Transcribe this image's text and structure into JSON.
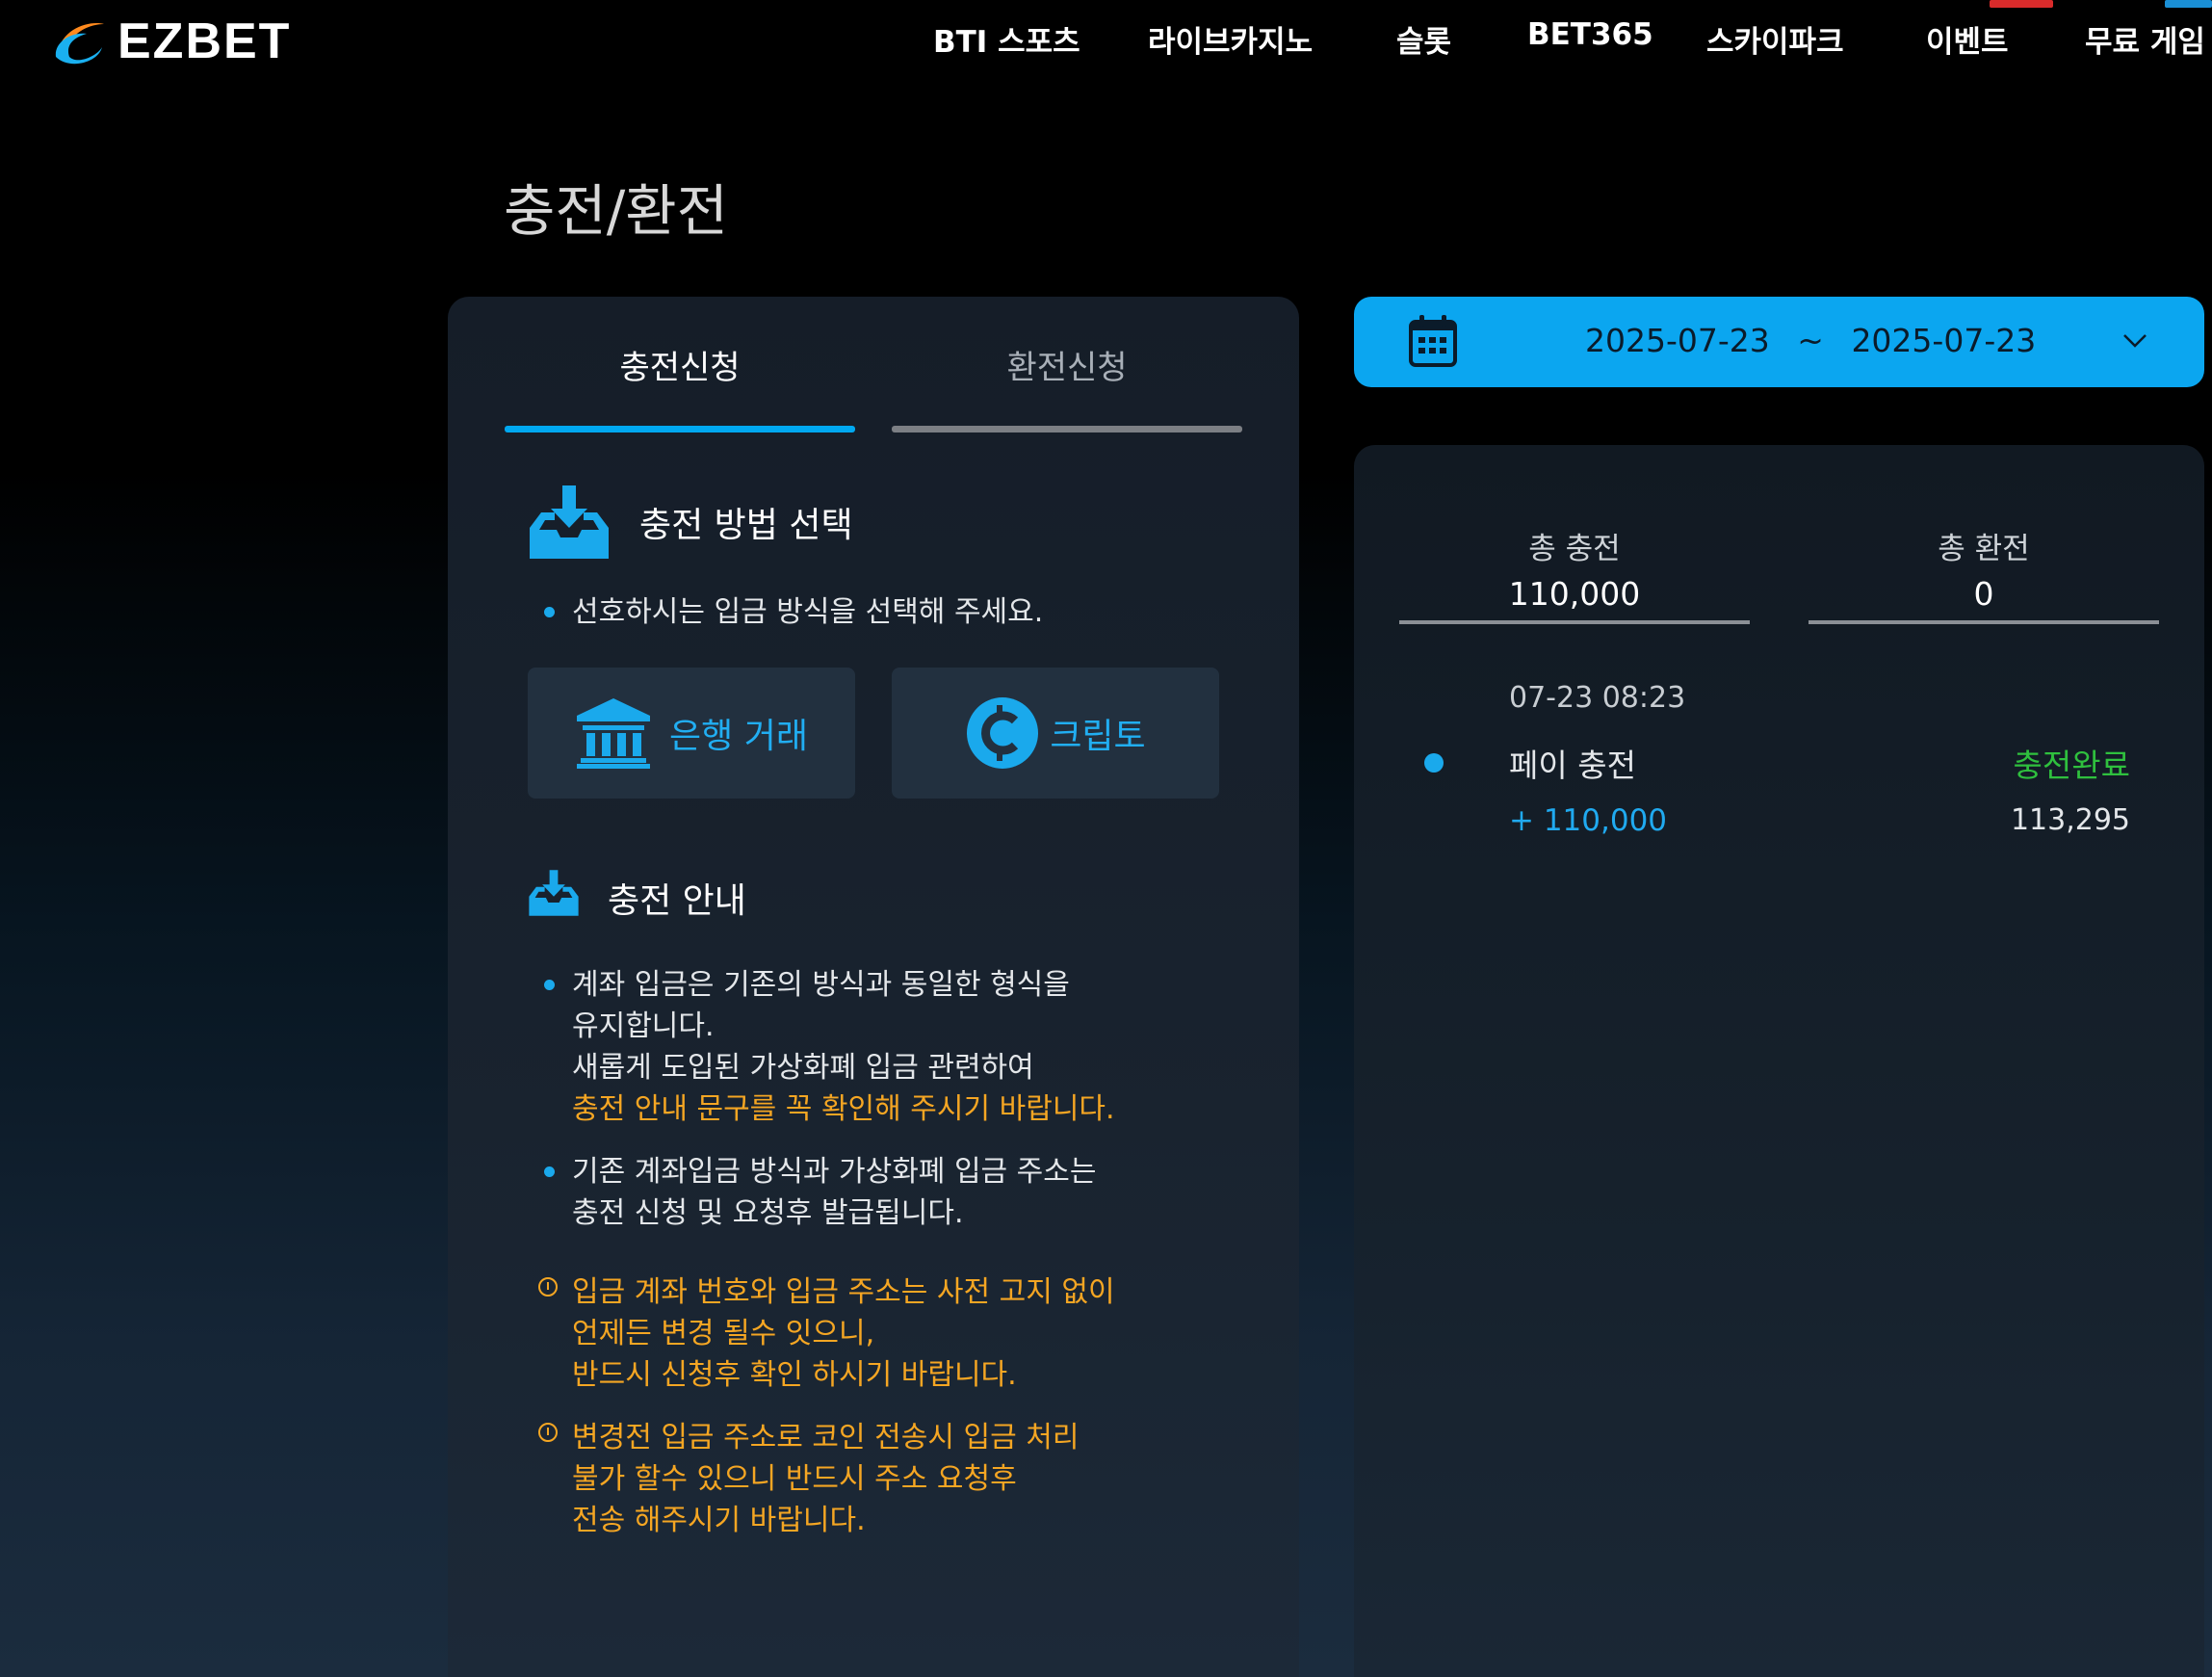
{
  "header": {
    "logo_text": "EZBET",
    "nav": [
      {
        "label": "BTI 스포츠"
      },
      {
        "label": "라이브카지노"
      },
      {
        "label": "슬롯"
      },
      {
        "label": "BET365"
      },
      {
        "label": "스카이파크"
      },
      {
        "label": "이벤트"
      },
      {
        "label": "무료 게임"
      }
    ],
    "colors": {
      "event_badge": "#d92b2b",
      "free_game_badge": "#1a8fd6"
    }
  },
  "page_title": "충전/환전",
  "tabs": {
    "deposit": "충전신청",
    "withdraw": "환전신청",
    "active": "deposit"
  },
  "method_section": {
    "title": "충전 방법 선택",
    "icon": "inbox-download-icon",
    "hint": "선호하시는 입금 방식을 선택해 주세요.",
    "methods": [
      {
        "label": "은행 거래",
        "icon": "bank-icon"
      },
      {
        "label": "크립토",
        "icon": "crypto-coin-icon"
      }
    ]
  },
  "guide_section": {
    "title": "충전 안내",
    "icon": "inbox-download-icon",
    "items": [
      {
        "type": "bullet",
        "lines": [
          "계좌 입금은 기존의 방식과 동일한 형식을",
          "유지합니다.",
          "새롭게 도입된 가상화폐 입금 관련하여"
        ],
        "highlight": "충전 안내 문구를 꼭 확인해 주시기 바랍니다."
      },
      {
        "type": "bullet",
        "lines": [
          "기존 계좌입금 방식과 가상화폐 입금 주소는",
          "충전 신청 및 요청후 발급됩니다."
        ]
      },
      {
        "type": "warning",
        "lines": [
          "입금 계좌 번호와 입금 주소는 사전 고지 없이",
          "언제든 변경 될수 잇으니,",
          "반드시 신청후 확인 하시기 바랍니다."
        ]
      },
      {
        "type": "warning",
        "lines": [
          "변경전 입금 주소로 코인 전송시 입금 처리",
          "불가 할수 있으니 반드시 주소 요청후",
          "전송 해주시기 바랍니다."
        ]
      }
    ]
  },
  "date_range": {
    "start": "2025-07-23",
    "separator": "~",
    "end": "2025-07-23",
    "icon": "calendar-icon"
  },
  "summary": {
    "total_deposit_label": "총 충전",
    "total_deposit_value": "110,000",
    "total_withdraw_label": "총 환전",
    "total_withdraw_value": "0"
  },
  "history": [
    {
      "datetime": "07-23 08:23",
      "name": "페이 충전",
      "status": "충전완료",
      "amount": "+ 110,000",
      "balance": "113,295"
    }
  ],
  "colors": {
    "accent": "#0ba6f0",
    "warning": "#f5a623",
    "success": "#2fc03e"
  }
}
